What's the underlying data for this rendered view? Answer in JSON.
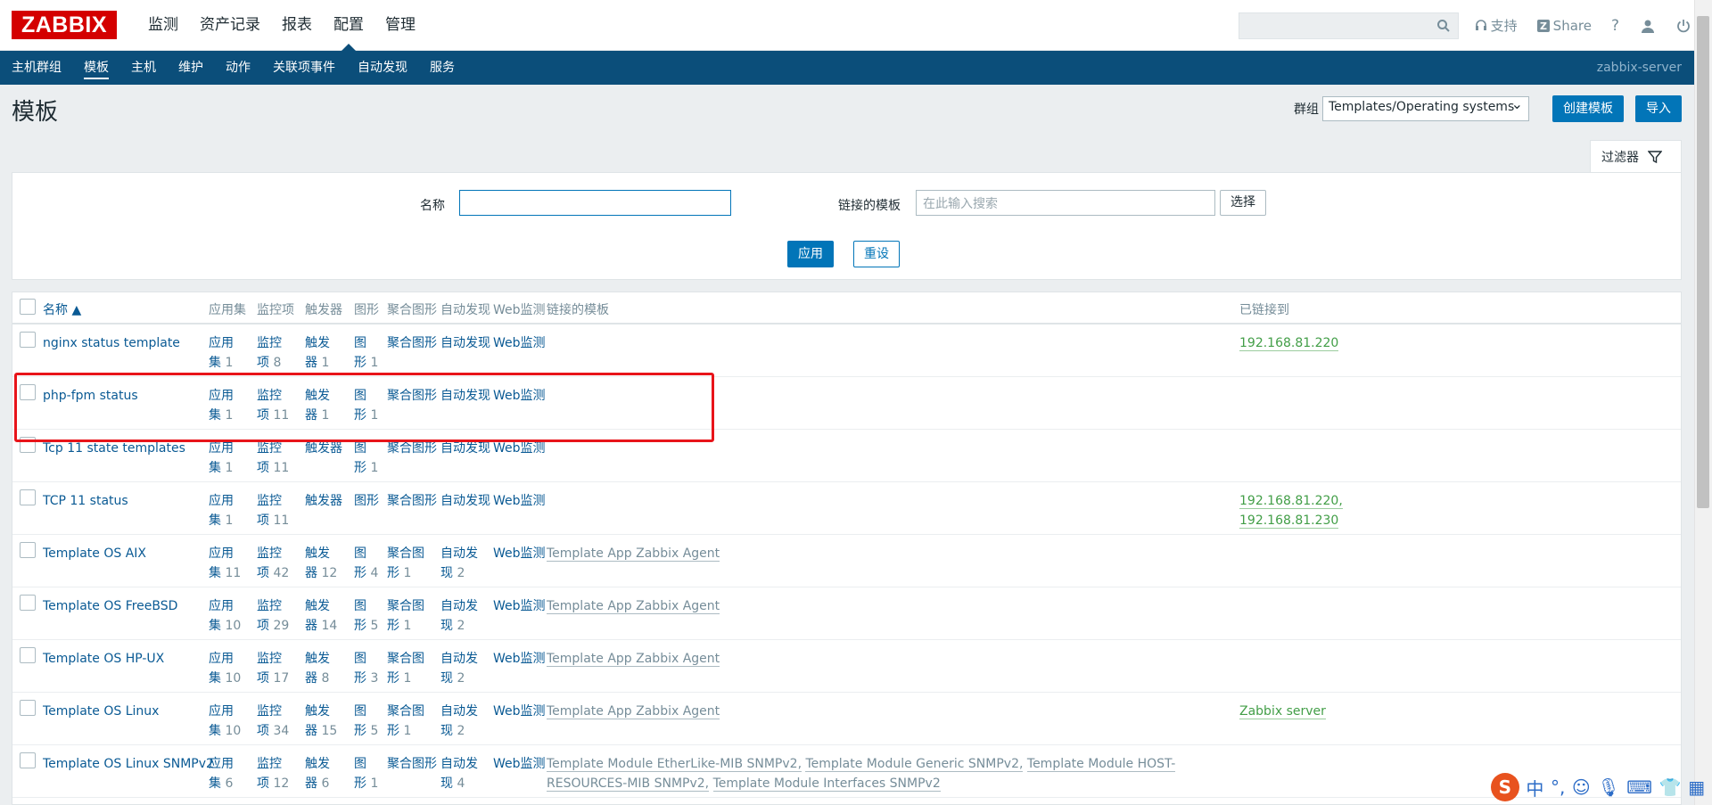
{
  "logo": "ZABBIX",
  "main_nav": [
    "监测",
    "资产记录",
    "报表",
    "配置",
    "管理"
  ],
  "main_nav_active": "配置",
  "top": {
    "support": "支持",
    "share": "Share",
    "help": "?"
  },
  "sub_nav": [
    "主机群组",
    "模板",
    "主机",
    "维护",
    "动作",
    "关联项事件",
    "自动发现",
    "服务"
  ],
  "server_name": "zabbix-server",
  "page_title": "模板",
  "group_label": "群组",
  "group_value": "Templates/Operating systems",
  "buttons": {
    "create": "创建模板",
    "import": "导入",
    "apply": "应用",
    "reset": "重设",
    "select": "选择"
  },
  "filter": {
    "tab": "过滤器",
    "name_label": "名称",
    "name_value": "",
    "linked_label": "链接的模板",
    "linked_placeholder": "在此输入搜索"
  },
  "columns": [
    "名称 ▲",
    "应用集",
    "监控项",
    "触发器",
    "图形",
    "聚合图形",
    "自动发现",
    "Web监测",
    "链接的模板",
    "已链接到"
  ],
  "rows": [
    {
      "name": "nginx status template",
      "app": [
        "应用",
        "集",
        "1"
      ],
      "items": [
        "监控",
        "项",
        "8"
      ],
      "triggers": [
        "触发",
        "器",
        "1"
      ],
      "graphs": [
        "图",
        "形",
        "1"
      ],
      "screens": [
        "聚合图形",
        "",
        ""
      ],
      "discovery": [
        "自动发现",
        "",
        ""
      ],
      "web": "Web监测",
      "linked": [],
      "linked_to": [
        "192.168.81.220"
      ]
    },
    {
      "name": "php-fpm status",
      "app": [
        "应用",
        "集",
        "1"
      ],
      "items": [
        "监控",
        "项",
        "11"
      ],
      "triggers": [
        "触发",
        "器",
        "1"
      ],
      "graphs": [
        "图",
        "形",
        "1"
      ],
      "screens": [
        "聚合图形",
        "",
        ""
      ],
      "discovery": [
        "自动发现",
        "",
        ""
      ],
      "web": "Web监测",
      "linked": [],
      "linked_to": []
    },
    {
      "name": "Tcp 11 state templates",
      "app": [
        "应用",
        "集",
        "1"
      ],
      "items": [
        "监控",
        "项",
        "11"
      ],
      "triggers": [
        "触发器",
        "",
        ""
      ],
      "graphs": [
        "图",
        "形",
        "1"
      ],
      "screens": [
        "聚合图形",
        "",
        ""
      ],
      "discovery": [
        "自动发现",
        "",
        ""
      ],
      "web": "Web监测",
      "linked": [],
      "linked_to": []
    },
    {
      "name": "TCP 11 status",
      "app": [
        "应用",
        "集",
        "1"
      ],
      "items": [
        "监控",
        "项",
        "11"
      ],
      "triggers": [
        "触发器",
        "",
        ""
      ],
      "graphs": [
        "图形",
        "",
        ""
      ],
      "screens": [
        "聚合图形",
        "",
        ""
      ],
      "discovery": [
        "自动发现",
        "",
        ""
      ],
      "web": "Web监测",
      "linked": [],
      "linked_to": [
        "192.168.81.220,",
        "192.168.81.230"
      ]
    },
    {
      "name": "Template OS AIX",
      "app": [
        "应用",
        "集",
        "11"
      ],
      "items": [
        "监控",
        "项",
        "42"
      ],
      "triggers": [
        "触发",
        "器",
        "12"
      ],
      "graphs": [
        "图",
        "形",
        "4"
      ],
      "screens": [
        "聚合图",
        "形",
        "1"
      ],
      "discovery": [
        "自动发",
        "现",
        "2"
      ],
      "web": "Web监测",
      "linked": [
        "Template App Zabbix Agent"
      ],
      "linked_to": []
    },
    {
      "name": "Template OS FreeBSD",
      "app": [
        "应用",
        "集",
        "10"
      ],
      "items": [
        "监控",
        "项",
        "29"
      ],
      "triggers": [
        "触发",
        "器",
        "14"
      ],
      "graphs": [
        "图",
        "形",
        "5"
      ],
      "screens": [
        "聚合图",
        "形",
        "1"
      ],
      "discovery": [
        "自动发",
        "现",
        "2"
      ],
      "web": "Web监测",
      "linked": [
        "Template App Zabbix Agent"
      ],
      "linked_to": []
    },
    {
      "name": "Template OS HP-UX",
      "app": [
        "应用",
        "集",
        "10"
      ],
      "items": [
        "监控",
        "项",
        "17"
      ],
      "triggers": [
        "触发",
        "器",
        "8"
      ],
      "graphs": [
        "图",
        "形",
        "3"
      ],
      "screens": [
        "聚合图",
        "形",
        "1"
      ],
      "discovery": [
        "自动发",
        "现",
        "2"
      ],
      "web": "Web监测",
      "linked": [
        "Template App Zabbix Agent"
      ],
      "linked_to": []
    },
    {
      "name": "Template OS Linux",
      "app": [
        "应用",
        "集",
        "10"
      ],
      "items": [
        "监控",
        "项",
        "34"
      ],
      "triggers": [
        "触发",
        "器",
        "15"
      ],
      "graphs": [
        "图",
        "形",
        "5"
      ],
      "screens": [
        "聚合图",
        "形",
        "1"
      ],
      "discovery": [
        "自动发",
        "现",
        "2"
      ],
      "web": "Web监测",
      "linked": [
        "Template App Zabbix Agent"
      ],
      "linked_to": [
        "Zabbix server"
      ]
    },
    {
      "name": "Template OS Linux SNMPv2",
      "app": [
        "应用",
        "集",
        "6"
      ],
      "items": [
        "监控",
        "项",
        "12"
      ],
      "triggers": [
        "触发",
        "器",
        "6"
      ],
      "graphs": [
        "图",
        "形",
        "1"
      ],
      "screens": [
        "聚合图形",
        "",
        ""
      ],
      "discovery": [
        "自动发",
        "现",
        "4"
      ],
      "web": "Web监测",
      "linked": [
        "Template Module EtherLike-MIB SNMPv2,",
        "Template Module Generic SNMPv2,",
        "Template Module HOST-RESOURCES-MIB SNMPv2,",
        "Template Module Interfaces SNMPv2"
      ],
      "linked_to": []
    }
  ],
  "ime": {
    "logo": "S",
    "lang": "中",
    "punct": "°,"
  }
}
